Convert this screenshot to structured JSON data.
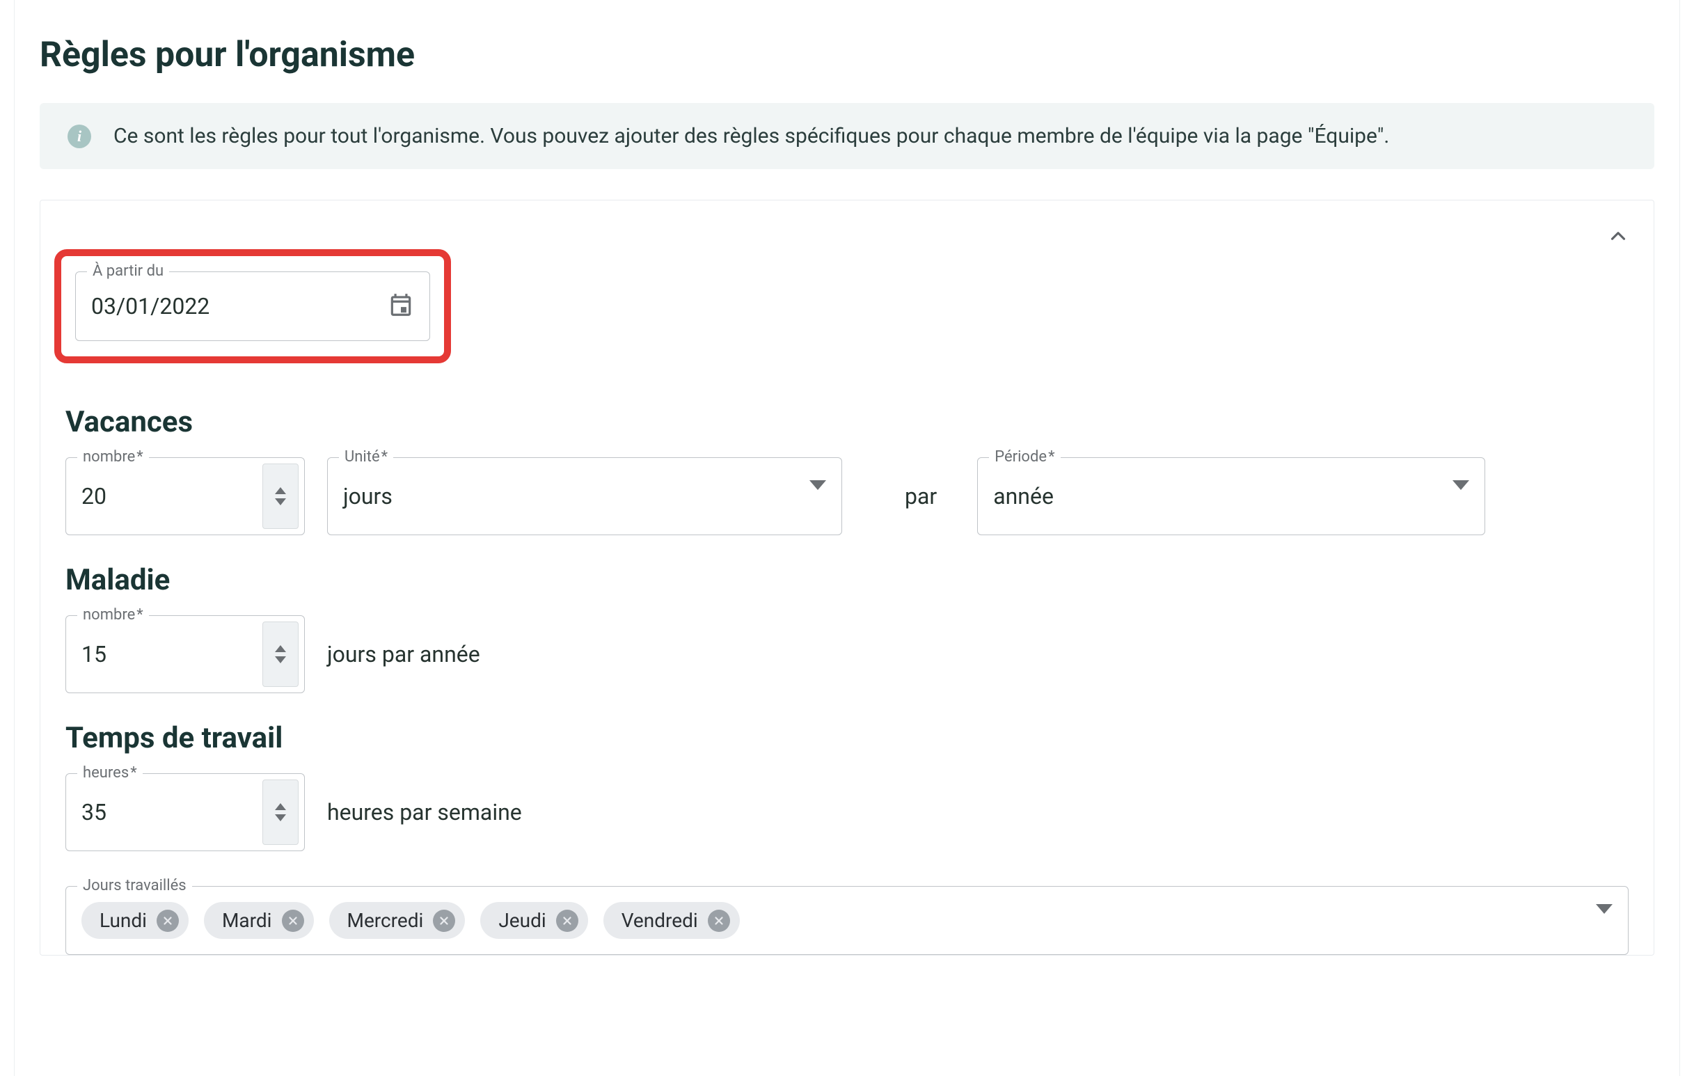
{
  "title": "Règles pour l'organisme",
  "info": {
    "icon": "i",
    "text": "Ce sont les règles pour tout l'organisme. Vous pouvez ajouter des règles spécifiques pour chaque membre de l'équipe via la page \"Équipe\"."
  },
  "dateField": {
    "label": "À partir du",
    "value": "03/01/2022"
  },
  "vacances": {
    "heading": "Vacances",
    "nombreLabel": "nombre",
    "nombreValue": "20",
    "uniteLabel": "Unité",
    "uniteValue": "jours",
    "par": "par",
    "periodeLabel": "Période",
    "periodeValue": "année"
  },
  "maladie": {
    "heading": "Maladie",
    "nombreLabel": "nombre",
    "nombreValue": "15",
    "suffix": "jours par année"
  },
  "travail": {
    "heading": "Temps de travail",
    "heuresLabel": "heures",
    "heuresValue": "35",
    "suffix": "heures par semaine",
    "joursLabel": "Jours travaillés",
    "jours": [
      "Lundi",
      "Mardi",
      "Mercredi",
      "Jeudi",
      "Vendredi"
    ]
  }
}
